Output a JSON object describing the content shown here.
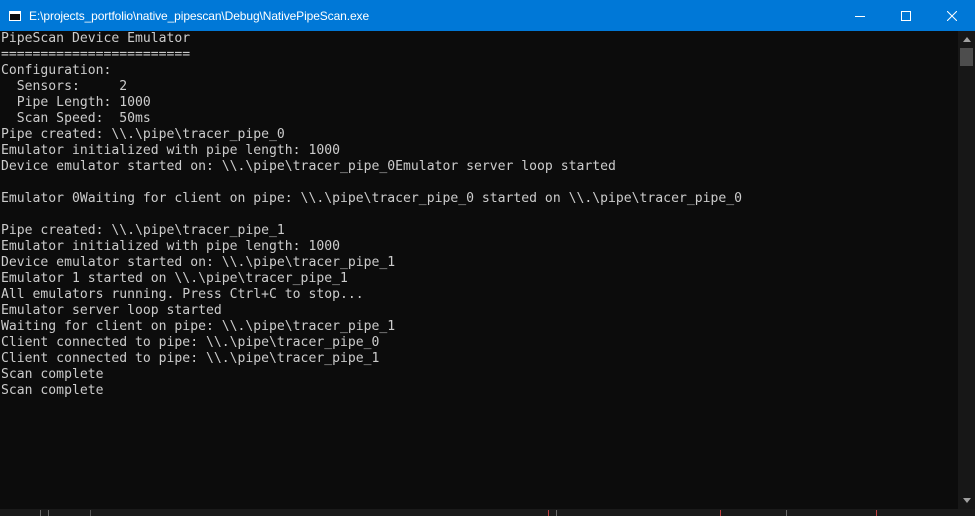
{
  "window": {
    "title": "E:\\projects_portfolio\\native_pipescan\\Debug\\NativePipeScan.exe",
    "icon": "console-app-icon",
    "controls": {
      "minimize_icon": "minimize-icon",
      "maximize_icon": "maximize-icon",
      "close_icon": "close-icon"
    }
  },
  "colors": {
    "titlebar": "#0078d7",
    "console_background": "#0c0c0c",
    "console_text": "#cccccc"
  },
  "console": {
    "lines": [
      "PipeScan Device Emulator",
      "========================",
      "Configuration:",
      "  Sensors:     2",
      "  Pipe Length: 1000",
      "  Scan Speed:  50ms",
      "Pipe created: \\\\.\\pipe\\tracer_pipe_0",
      "Emulator initialized with pipe length: 1000",
      "Device emulator started on: \\\\.\\pipe\\tracer_pipe_0Emulator server loop started",
      "",
      "Emulator 0Waiting for client on pipe: \\\\.\\pipe\\tracer_pipe_0 started on \\\\.\\pipe\\tracer_pipe_0",
      "",
      "Pipe created: \\\\.\\pipe\\tracer_pipe_1",
      "Emulator initialized with pipe length: 1000",
      "Device emulator started on: \\\\.\\pipe\\tracer_pipe_1",
      "Emulator 1 started on \\\\.\\pipe\\tracer_pipe_1",
      "All emulators running. Press Ctrl+C to stop...",
      "Emulator server loop started",
      "Waiting for client on pipe: \\\\.\\pipe\\tracer_pipe_1",
      "Client connected to pipe: \\\\.\\pipe\\tracer_pipe_0",
      "Client connected to pipe: \\\\.\\pipe\\tracer_pipe_1",
      "Scan complete",
      "Scan complete"
    ]
  },
  "scrollbar": {
    "up_icon": "scroll-up-arrow-icon",
    "down_icon": "scroll-down-arrow-icon"
  }
}
